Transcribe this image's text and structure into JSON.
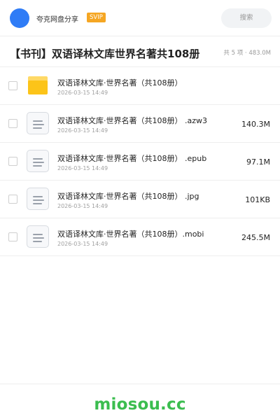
{
  "header": {
    "app_name": "夸克网盘分享",
    "badge": "SVIP",
    "search_placeholder": "搜索",
    "accent_color": "#2f7cf6",
    "badge_color": "#f5a623"
  },
  "folder": {
    "title": "【书刊】双语译林文库世界名著共108册",
    "summary": "共 5 项 · 483.0M"
  },
  "files": [
    {
      "name": "双语译林文库·世界名著（共108册）",
      "date": "2026-03-15 14:49",
      "size": "",
      "icon": "folder-icon"
    },
    {
      "name": "双语译林文库·世界名著（共108册） .azw3",
      "date": "2026-03-15 14:49",
      "size": "140.3M",
      "icon": "document-icon"
    },
    {
      "name": "双语译林文库·世界名著（共108册） .epub",
      "date": "2026-03-15 14:49",
      "size": "97.1M",
      "icon": "document-icon"
    },
    {
      "name": "双语译林文库·世界名著（共108册） .jpg",
      "date": "2026-03-15 14:49",
      "size": "101KB",
      "icon": "document-icon"
    },
    {
      "name": "双语译林文库·世界名著（共108册）.mobi",
      "date": "2026-03-15 14:49",
      "size": "245.5M",
      "icon": "document-icon"
    }
  ],
  "footer": {
    "watermark": "miosou.cc",
    "watermark_color": "#3bbd4f"
  }
}
